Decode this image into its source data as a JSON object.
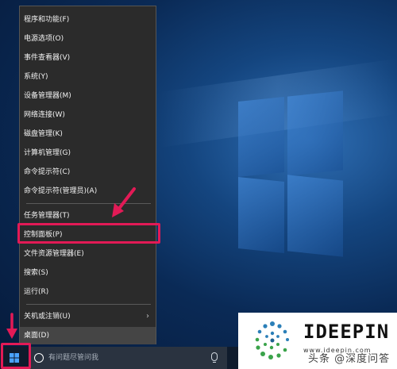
{
  "menu": {
    "items": [
      {
        "label": "程序和功能(F)"
      },
      {
        "label": "电源选项(O)"
      },
      {
        "label": "事件查看器(V)"
      },
      {
        "label": "系统(Y)"
      },
      {
        "label": "设备管理器(M)"
      },
      {
        "label": "网络连接(W)"
      },
      {
        "label": "磁盘管理(K)"
      },
      {
        "label": "计算机管理(G)"
      },
      {
        "label": "命令提示符(C)"
      },
      {
        "label": "命令提示符(管理员)(A)"
      },
      {
        "label": "任务管理器(T)"
      },
      {
        "label": "控制面板(P)"
      },
      {
        "label": "文件资源管理器(E)"
      },
      {
        "label": "搜索(S)"
      },
      {
        "label": "运行(R)"
      },
      {
        "label": "关机或注销(U)"
      },
      {
        "label": "桌面(D)"
      }
    ],
    "highlighted_item": "控制面板(P)"
  },
  "taskbar": {
    "search_placeholder": "有问题尽管问我"
  },
  "logo_card": {
    "brand": "IDEEPIN",
    "url": "www.ideepin.com",
    "watermark": "头条 @深度问答"
  },
  "colors": {
    "highlight_box": "#e21a56",
    "menu_bg": "#2b2b2b",
    "taskbar_bg": "#0f1b2c"
  }
}
